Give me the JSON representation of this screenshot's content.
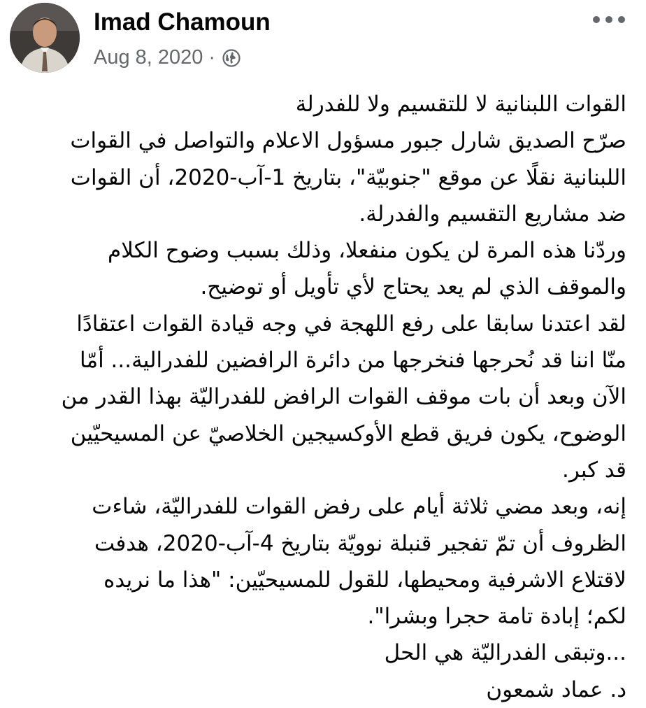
{
  "post": {
    "author": "Imad Chamoun",
    "date": "Aug 8, 2020",
    "separator": "·",
    "privacy_icon": "globe-icon",
    "more_icon": "more-options-icon",
    "lines": [
      "القوات اللبنانية لا للتقسيم ولا للفدرلة",
      "صرّح الصديق شارل جبور مسؤول الاعلام والتواصل في القوات",
      "اللبنانية نقلًا عن موقع \"جنوبيّة\"، بتاريخ 1-آب-2020، أن القوات",
      "ضد مشاريع التقسيم والفدرلة.",
      "وردّنا هذه المرة لن يكون منفعلا، وذلك بسبب وضوح الكلام",
      "والموقف الذي لم يعد يحتاج لأي تأويل أو توضيح.",
      "لقد اعتدنا سابقا على رفع اللهجة في وجه قيادة القوات اعتقادًا",
      "منّا اننا قد نُحرجها فنخرجها من دائرة الرافضين للفدرالية... أمّا",
      "الآن وبعد أن بات موقف القوات الرافض للفدراليّة بهذا القدر من",
      "الوضوح، يكون فريق قطع الأوكسيجين الخلاصيّ عن المسيحيّين",
      "قد كبر.",
      "إنه، وبعد مضي ثلاثة أيام على رفض القوات للفدراليّة، شاءت",
      "الظروف أن تمّ تفجير قنبلة نوويّة بتاريخ 4-آب-2020، هدفت",
      "لاقتلاع الاشرفية ومحيطها، للقول للمسيحيّين: \"هذا ما نريده",
      "لكم؛ إبادة تامة حجرا وبشرا\".",
      "...وتبقى الفدراليّة هي الحل",
      "د. عماد شمعون"
    ]
  }
}
